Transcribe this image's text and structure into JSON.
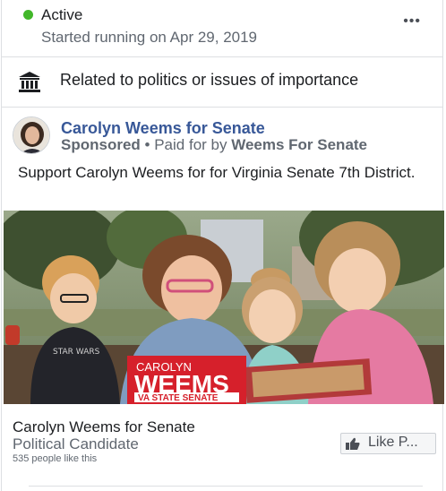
{
  "status": {
    "label": "Active",
    "started": "Started running on Apr 29, 2019",
    "more": "•••",
    "active_color": "#42b72a"
  },
  "politics": {
    "icon": "government-building-icon",
    "text": "Related to politics or issues of importance"
  },
  "ad": {
    "page_name": "Carolyn Weems for Senate",
    "sponsored": "Sponsored",
    "separator": "•",
    "paid_for_prefix": "Paid for by",
    "paid_for_by": "Weems For Senate",
    "body": "Support Carolyn Weems for for Virginia Senate 7th District.",
    "image": {
      "logo_line1": "CAROLYN",
      "logo_line2": "WEEMS",
      "logo_line3": "VA STATE SENATE",
      "shirt_text": "STAR WARS"
    }
  },
  "footer": {
    "title": "Carolyn Weems for Senate",
    "category": "Political Candidate",
    "likes": "535 people like this",
    "like_button": "Like P..."
  },
  "colors": {
    "link": "#385898",
    "muted": "#606770",
    "border": "#dddfe2",
    "logo_red": "#d6202b"
  }
}
